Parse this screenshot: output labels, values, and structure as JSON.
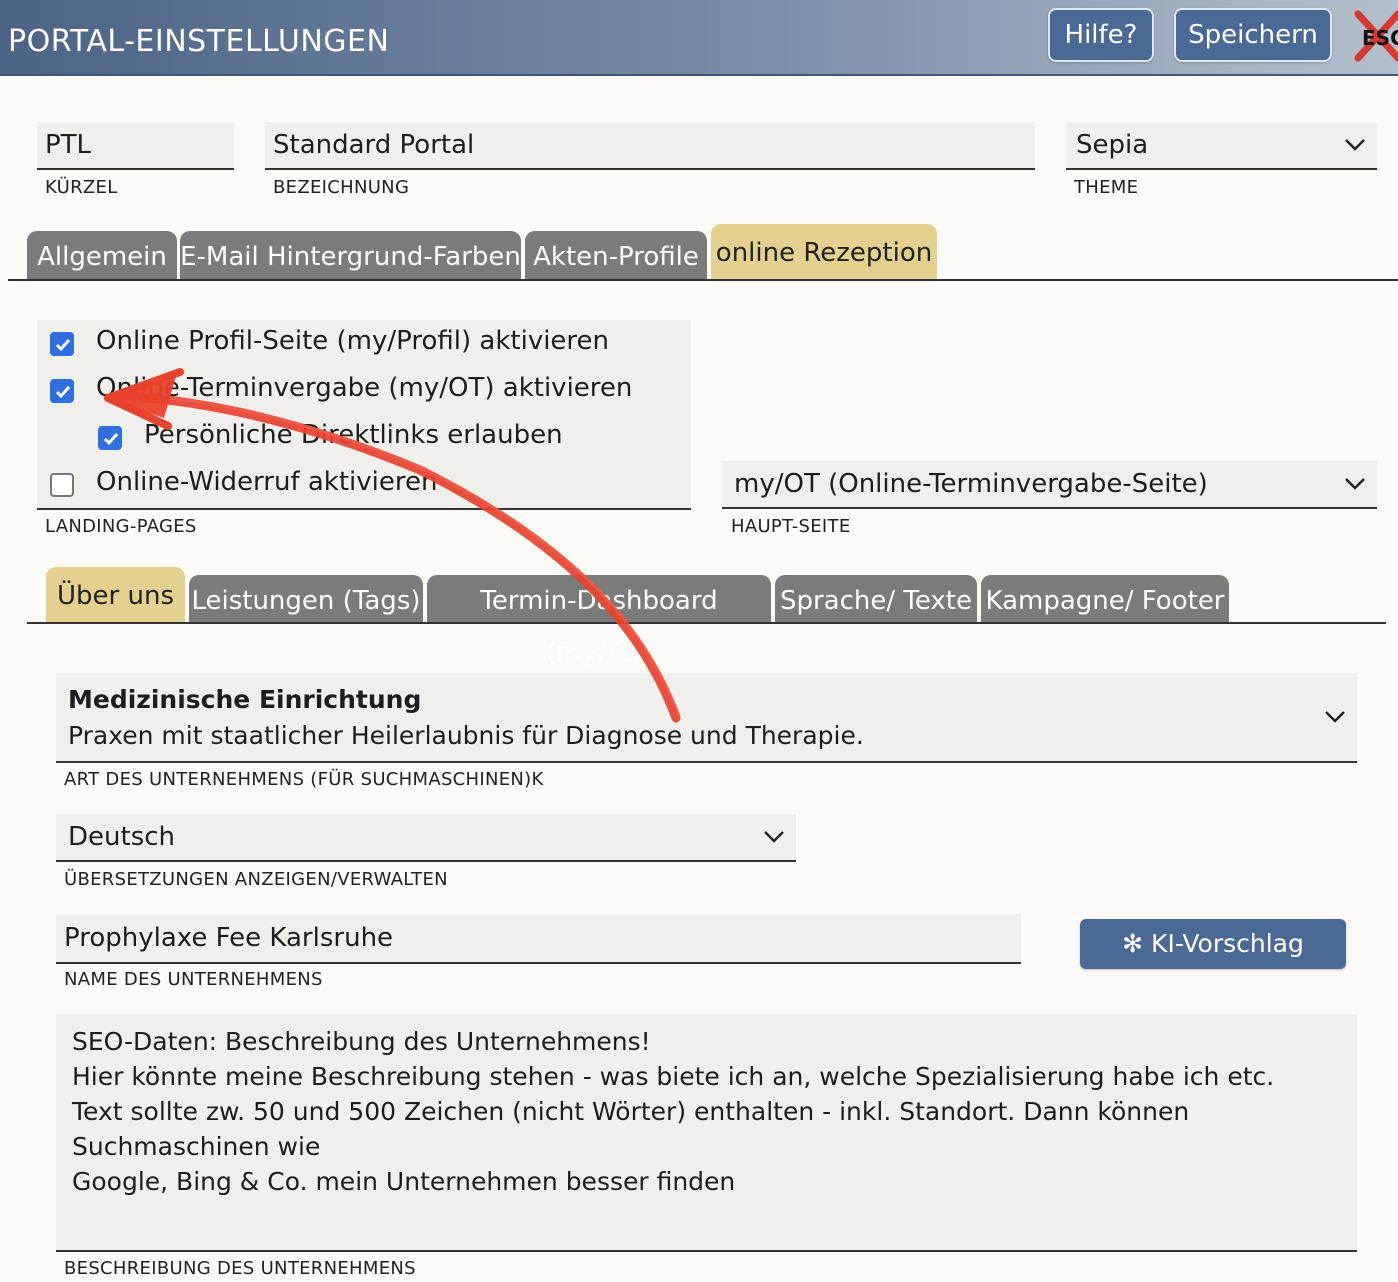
{
  "header": {
    "title": "PORTAL-EINSTELLUNGEN",
    "help_label": "Hilfe?",
    "save_label": "Speichern",
    "esc_label": "ESC"
  },
  "top_fields": {
    "kuerzel": {
      "value": "PTL",
      "label": "KÜRZEL"
    },
    "bezeichnung": {
      "value": "Standard Portal",
      "label": "BEZEICHNUNG"
    },
    "theme": {
      "value": "Sepia",
      "label": "THEME"
    }
  },
  "main_tabs": [
    {
      "label": "Allgemein",
      "active": false
    },
    {
      "label": "E-Mail Hintergrund-Farben",
      "active": false
    },
    {
      "label": "Akten-Profile",
      "active": false
    },
    {
      "label": "online Rezeption",
      "active": true
    }
  ],
  "landing_pages": {
    "label": "LANDING-PAGES",
    "items": [
      {
        "label": "Online Profil-Seite (my/Profil) aktivieren",
        "checked": true
      },
      {
        "label": "Online-Terminvergabe (my/OT) aktivieren",
        "checked": true
      },
      {
        "label": "Persönliche Direktlinks erlauben",
        "checked": true
      },
      {
        "label": "Online-Widerruf aktivieren",
        "checked": false
      }
    ]
  },
  "haupt_seite": {
    "value": "my/OT (Online-Terminvergabe-Seite)",
    "label": "HAUPT-SEITE"
  },
  "sub_tabs": [
    {
      "label": "Über uns",
      "active": true
    },
    {
      "label": "Leistungen (Tags)",
      "active": false
    },
    {
      "label": "Termin-Dashboard (my/TD)",
      "active": false
    },
    {
      "label": "Sprache/ Texte",
      "active": false
    },
    {
      "label": "Kampagne/ Footer",
      "active": false
    }
  ],
  "art_unternehmen": {
    "title": "Medizinische Einrichtung",
    "description": "Praxen mit staatlicher Heilerlaubnis für Diagnose und Therapie.",
    "label": "ART DES UNTERNEHMENS (FÜR SUCHMASCHINEN)K"
  },
  "uebersetzungen": {
    "value": "Deutsch",
    "label": "ÜBERSETZUNGEN ANZEIGEN/VERWALTEN"
  },
  "name_unternehmen": {
    "value": "Prophylaxe Fee Karlsruhe",
    "label": "NAME DES UNTERNEHMENS"
  },
  "ki_button": {
    "label": "KI-Vorschlag"
  },
  "beschreibung": {
    "lines": [
      "SEO-Daten: Beschreibung des Unternehmens!",
      "Hier könnte meine Beschreibung stehen - was biete ich an, welche Spezialisierung habe ich etc.",
      "Text sollte zw. 50 und 500 Zeichen (nicht Wörter) enthalten - inkl. Standort. Dann können Suchmaschinen wie",
      "Google, Bing & Co. mein Unternehmen besser finden"
    ],
    "label": "BESCHREIBUNG DES UNTERNEHMENS"
  },
  "colors": {
    "accent_blue": "#4a6a95",
    "tab_active": "#e4d08f",
    "tab_inactive": "#7b7b7b",
    "checkbox": "#2f6fe0",
    "annotation_arrow": "#e8412c"
  }
}
